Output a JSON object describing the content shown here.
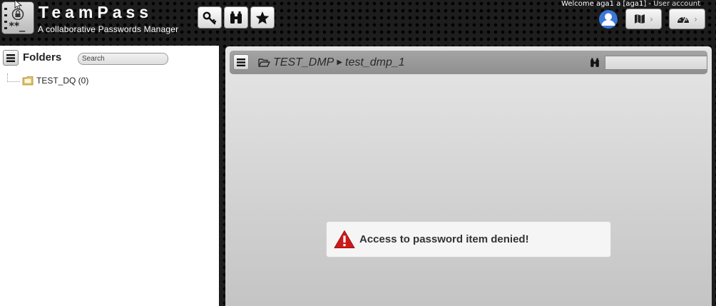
{
  "app": {
    "brand_name": "TeamPass",
    "tagline": "A collaborative Passwords Manager",
    "logo_stars": "**_"
  },
  "header": {
    "buttons": [
      {
        "name": "key-button",
        "icon": "key-icon"
      },
      {
        "name": "binoculars-button",
        "icon": "binoculars-icon"
      },
      {
        "name": "favorites-button",
        "icon": "star-icon"
      }
    ],
    "welcome_text": "Welcome aga1 a [aga1]",
    "welcome_sep": " - ",
    "user_account_label": "User account",
    "right_buttons": [
      {
        "name": "map-menu-button",
        "icon": "map-icon"
      },
      {
        "name": "dashboard-menu-button",
        "icon": "dashboard-icon"
      }
    ]
  },
  "sidebar": {
    "title": "Folders",
    "search_placeholder": "Search",
    "tree": [
      {
        "label": "TEST_DQ (0)"
      }
    ]
  },
  "main": {
    "breadcrumb": {
      "parent": "TEST_DMP",
      "current": "test_dmp_1"
    },
    "item_search_value": "",
    "alert": {
      "icon": "warning-icon",
      "message": "Access to password item denied!"
    }
  },
  "colors": {
    "header_bg": "#1d1d1d",
    "panel_bg": "#ffffff",
    "path_bar": "#9a9a9a",
    "warning_red": "#cc1a1a"
  }
}
